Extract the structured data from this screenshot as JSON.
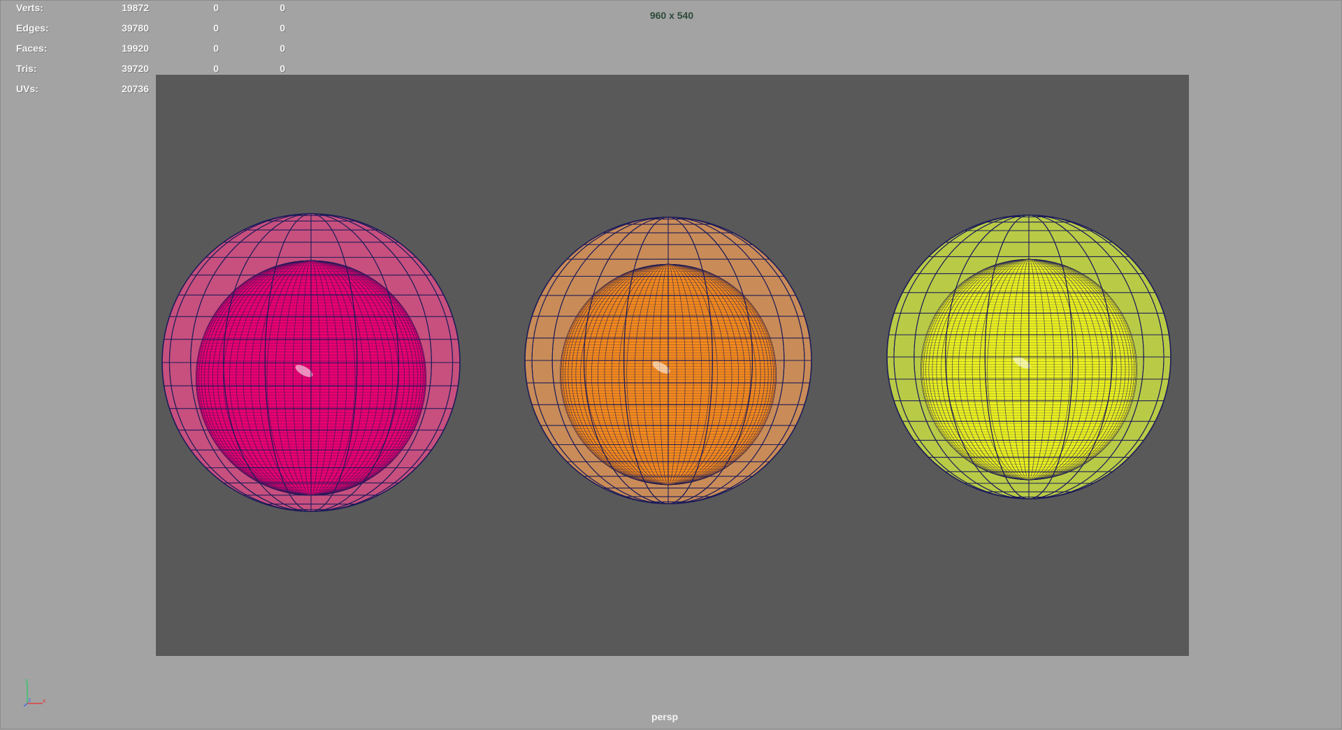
{
  "hud": {
    "rows": [
      {
        "label": "Verts:",
        "total": "19872",
        "selected": "0",
        "uv": "0"
      },
      {
        "label": "Edges:",
        "total": "39780",
        "selected": "0",
        "uv": "0"
      },
      {
        "label": "Faces:",
        "total": "19920",
        "selected": "0",
        "uv": "0"
      },
      {
        "label": "Tris:",
        "total": "39720",
        "selected": "0",
        "uv": "0"
      },
      {
        "label": "UVs:",
        "total": "20736",
        "selected": "0",
        "uv": "0"
      }
    ]
  },
  "viewport": {
    "resolution": "960 x 540",
    "camera": "persp"
  },
  "axis_gizmo": {
    "y": "y",
    "x": "x",
    "z": "z"
  },
  "objects": [
    {
      "name": "pink",
      "outer_color": "#c7507e",
      "inner_color": "#e8006f"
    },
    {
      "name": "orange",
      "outer_color": "#c98c58",
      "inner_color": "#f58a1c"
    },
    {
      "name": "yellow",
      "outer_color": "#b9cb46",
      "inner_color": "#ecf21e"
    }
  ],
  "colors": {
    "viewport_bg": "#a3a3a3",
    "gate_bg": "#595959",
    "wire": "#1c1c5a"
  }
}
